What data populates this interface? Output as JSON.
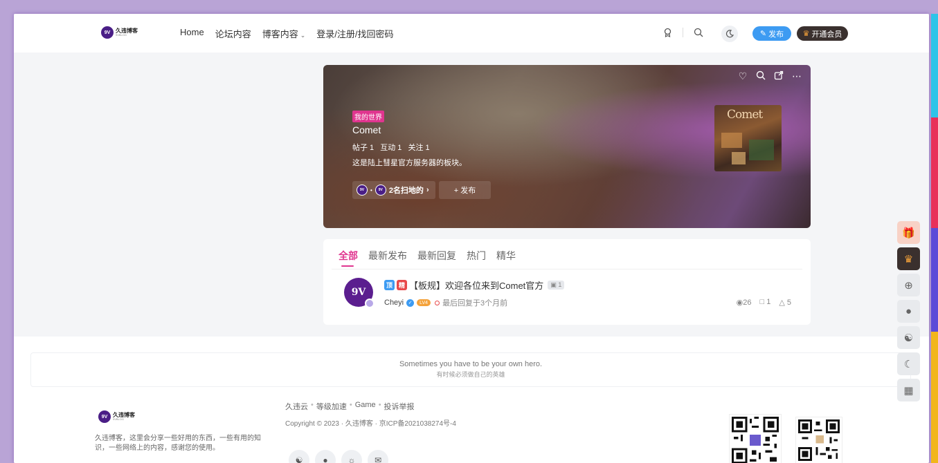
{
  "header": {
    "logo_mark": "9V",
    "logo_name": "久违博客",
    "logo_sub": "9VBLOG",
    "nav": {
      "home": "Home",
      "forum": "论坛内容",
      "blog": "博客内容",
      "login": "登录/注册/找回密码"
    },
    "publish_label": "发布",
    "vip_label": "开通会员"
  },
  "banner": {
    "tag": "我的世界",
    "board_name": "Comet",
    "stats": {
      "posts": "帖子 1",
      "interactions": "互动 1",
      "follows": "关注 1"
    },
    "description": "这是陆上彗星官方服务器的板块。",
    "moderators_label": "2名扫地的",
    "publish_label": "+ 发布",
    "cover_text": "Comet"
  },
  "posts": {
    "tabs": [
      "全部",
      "最新发布",
      "最新回复",
      "热门",
      "精华"
    ],
    "items": [
      {
        "avatar_text": "9V",
        "badge_top": "顶",
        "badge_essence": "精",
        "title": "【板规】欢迎各位来到Comet官方",
        "image_count": "1",
        "author": "Cheyi",
        "level": "LV4",
        "last_reply": "最后回复于3个月前",
        "views": "26",
        "comments": "1",
        "likes": "5"
      }
    ]
  },
  "footer": {
    "motto_en": "Sometimes you have to be your own hero.",
    "motto_cn": "有时候必须做自己的英雄",
    "logo_name": "久违博客",
    "description": "久违博客，这里会分享一些好用的东西，一些有用的知识，一些网络上的内容，感谢您的使用。",
    "links": [
      "久违云",
      "等级加速",
      "Game",
      "投诉举报"
    ],
    "copyright": "Copyright © 2023 · 久违博客 · 京ICP备2021038274号-4"
  },
  "colors": {
    "accent_pink": "#e0358f",
    "accent_blue": "#3d9bf2",
    "brand_purple": "#4a1e86"
  }
}
